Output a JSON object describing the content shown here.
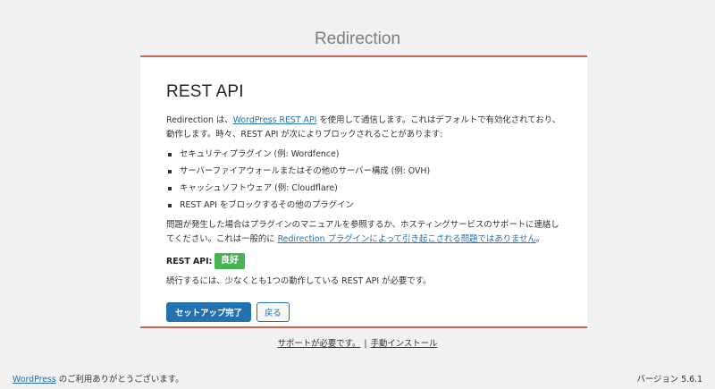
{
  "app": {
    "title": "Redirection"
  },
  "card": {
    "heading": "REST API",
    "intro_before_link": "Redirection は、",
    "intro_link": "WordPress REST API",
    "intro_after_link": " を使用して通信します。これはデフォルトで有効化されており、動作します。時々、REST API が次によりブロックされることがあります:",
    "blockers": [
      "セキュリティプラグイン (例: Wordfence)",
      "サーバーファイアウォールまたはその他のサーバー構成 (例: OVH)",
      "キャッシュソフトウェア (例: Cloudflare)",
      "REST API をブロックするその他のプラグイン"
    ],
    "problem_text": "問題が発生した場合はプラグインのマニュアルを参照するか、ホスティングサービスのサポートに連絡してください。これは一般的に ",
    "problem_link": "Redirection プラグインによって引き起こされる問題ではありません",
    "problem_end": "。",
    "status_label": "REST API:",
    "status_value": "良好",
    "continue_text": "続行するには、少なくとも1つの動作している REST API が必要です。",
    "finish_button": "セットアップ完了",
    "back_button": "戻る"
  },
  "support": {
    "help_link": "サポートが必要です。",
    "separator": "|",
    "manual_link": "手動インストール"
  },
  "footer": {
    "wp_link": "WordPress",
    "thanks": " のご利用ありがとうございます。",
    "version": "バージョン 5.6.1"
  },
  "colors": {
    "accent": "#2271b1",
    "card_border": "#c7664f",
    "status_good": "#46b450"
  }
}
